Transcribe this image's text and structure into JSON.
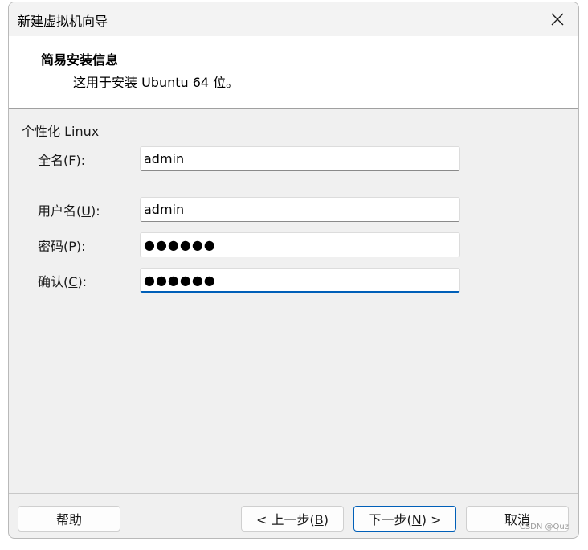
{
  "window": {
    "title": "新建虚拟机向导"
  },
  "header": {
    "title": "简易安装信息",
    "subtitle": "这用于安装 Ubuntu 64 位。"
  },
  "section": {
    "title": "个性化 Linux"
  },
  "fields": {
    "fullname": {
      "label": "全名",
      "mnemonic": "F",
      "value": "admin"
    },
    "username": {
      "label": "用户名",
      "mnemonic": "U",
      "value": "admin"
    },
    "password": {
      "label": "密码",
      "mnemonic": "P",
      "value": "●●●●●●"
    },
    "confirm": {
      "label": "确认",
      "mnemonic": "C",
      "value": "●●●●●●"
    }
  },
  "buttons": {
    "help": "帮助",
    "back": {
      "prefix": "< 上一步(",
      "mnemonic": "B",
      "suffix": ")"
    },
    "next": {
      "prefix": "下一步(",
      "mnemonic": "N",
      "suffix": ") >"
    },
    "cancel": "取消"
  },
  "watermark": "CSDN @Quz",
  "colors": {
    "accent": "#005fb8",
    "dialog_bg": "#f0f0f0"
  }
}
